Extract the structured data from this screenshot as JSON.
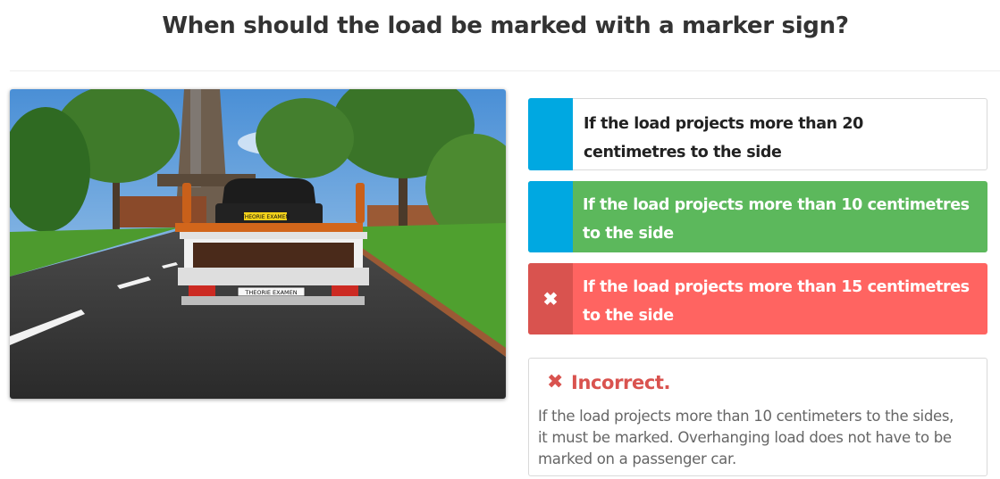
{
  "question": "When should the load be marked with a marker sign?",
  "scene": {
    "plate_car": "THEORIE EXAMEN",
    "plate_trailer": "THEORIE EXAMEN"
  },
  "answers": [
    {
      "text": "If the load projects more than 20 centimetres to the side",
      "state": "neutral",
      "icon": ""
    },
    {
      "text": "If the load projects more than 10 centimetres to the side",
      "state": "correct",
      "icon": ""
    },
    {
      "text": "If the load projects more than 15 centimetres to the side",
      "state": "wrong",
      "icon": "✖"
    }
  ],
  "feedback": {
    "icon": "✖",
    "title": "Incorrect.",
    "text": "If the load projects more than 10 centimeters to the sides, it must be marked. Overhanging load does not have to be marked on a passenger car."
  },
  "colors": {
    "accent": "#00a8e1",
    "correct": "#5cb85c",
    "wrong": "#ff6461",
    "wrong_dark": "#d9534f"
  }
}
